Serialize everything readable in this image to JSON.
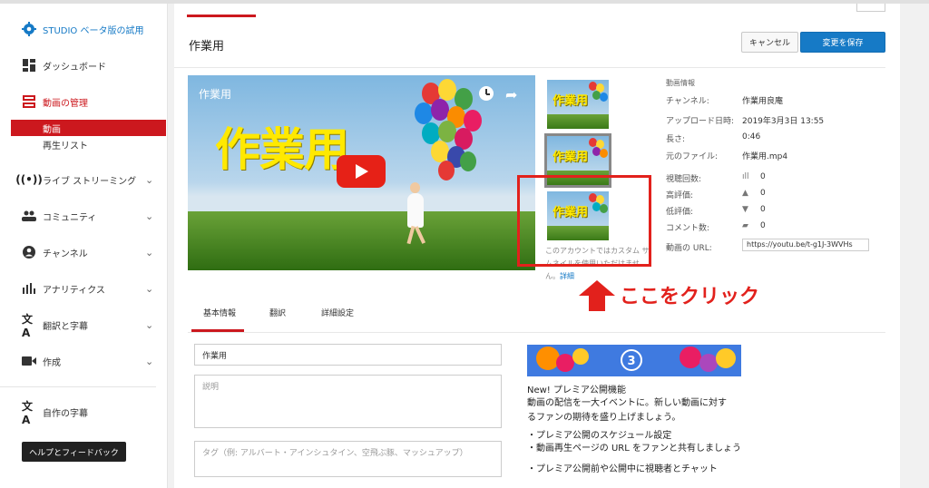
{
  "sidebar": {
    "studio_beta": "STUDIO ベータ版の試用",
    "dashboard": "ダッシュボード",
    "video_manager": "動画の管理",
    "videos": "動画",
    "playlists": "再生リスト",
    "live": "ライブ ストリーミング",
    "community": "コミュニティ",
    "channel": "チャンネル",
    "analytics": "アナリティクス",
    "translations": "翻訳と字幕",
    "create": "作成",
    "your_subtitles": "自作の字幕",
    "help_feedback": "ヘルプとフィードバック"
  },
  "header": {
    "title": "作業用",
    "cancel": "キャンセル",
    "save": "変更を保存"
  },
  "video": {
    "overlay_title": "作業用",
    "big_text": "作業用"
  },
  "thumbnails": {
    "label": "作業用",
    "custom_note": "このアカウントではカスタム サムネイルを使用いただけません。",
    "details_link": "詳細"
  },
  "info": {
    "heading": "動画情報",
    "channel_label": "チャンネル:",
    "channel_value": "作業用良庵",
    "upload_label": "アップロード日時:",
    "upload_value": "2019年3月3日 13:55",
    "length_label": "長さ:",
    "length_value": "0:46",
    "file_label": "元のファイル:",
    "file_value": "作業用.mp4",
    "views_label": "視聴回数:",
    "views_value": "0",
    "likes_label": "高評価:",
    "likes_value": "0",
    "dislikes_label": "低評価:",
    "dislikes_value": "0",
    "comments_label": "コメント数:",
    "comments_value": "0",
    "url_label": "動画の URL:",
    "url_value": "https://youtu.be/t-g1J-3WVHs"
  },
  "annotation": {
    "text": "ここをクリック"
  },
  "tabs": [
    "基本情報",
    "翻訳",
    "詳細設定"
  ],
  "form": {
    "title_value": "作業用",
    "description_placeholder": "説明",
    "tags_placeholder": "タグ（例: アルバート・アインシュタイン、空飛ぶ豚、マッシュアップ）"
  },
  "promo": {
    "badge_number": "3",
    "title": "New! プレミア公開機能",
    "line1": "動画の配信を一大イベントに。新しい動画に対す",
    "line2": "るファンの期待を盛り上げましょう。",
    "bullet1": "・プレミア公開のスケジュール設定",
    "bullet2": "・動画再生ページの URL をファンと共有しましょう",
    "bullet3": "・プレミア公開前や公開中に視聴者とチャット"
  },
  "colors": {
    "accent_red": "#cc181e",
    "save_blue": "#167ac6",
    "studio_blue": "#167ac6",
    "annotation_red": "#e2211c",
    "thumb_text_yellow": "#ffe900"
  }
}
